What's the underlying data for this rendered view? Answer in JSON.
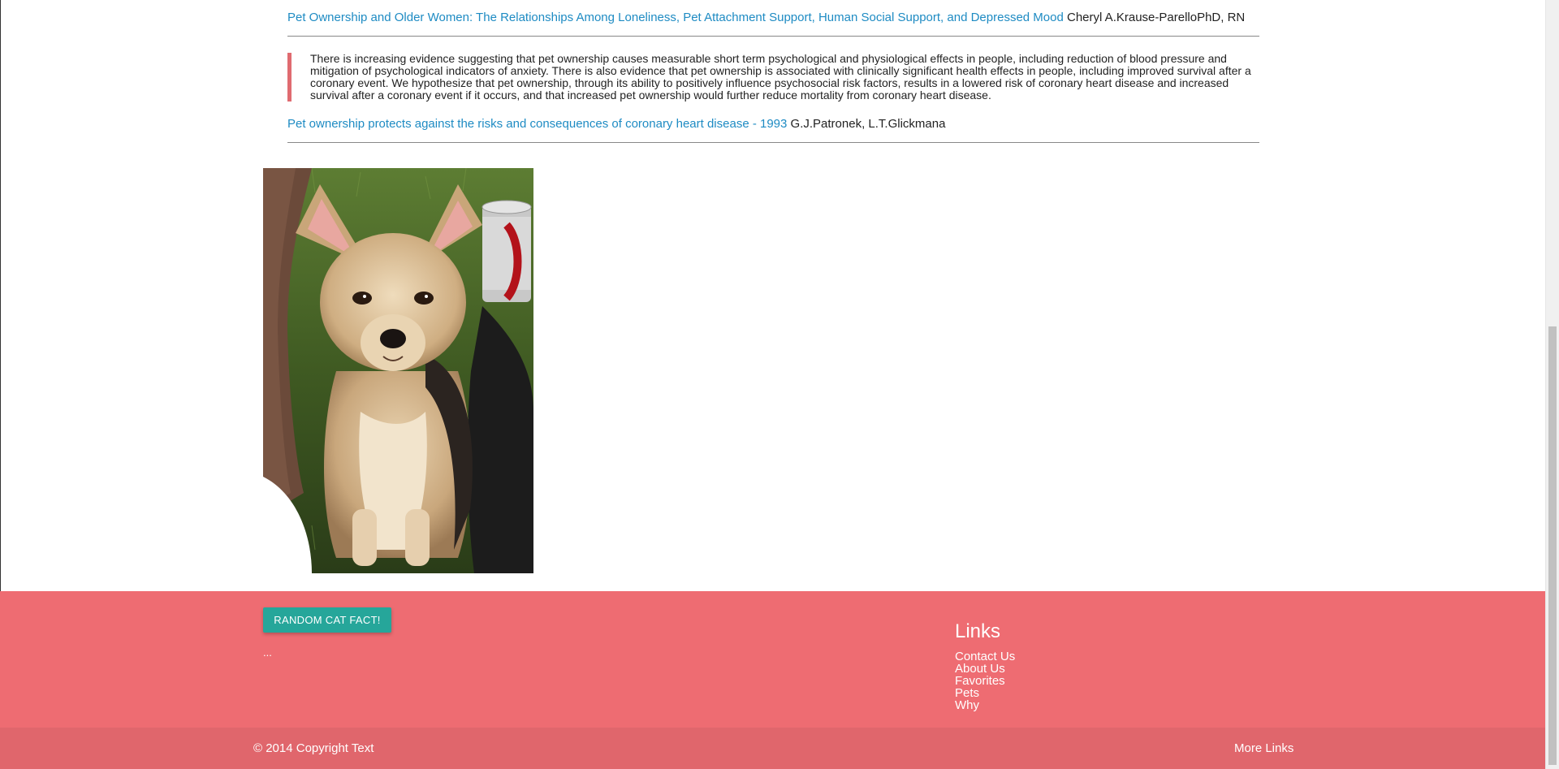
{
  "references": [
    {
      "title": "Pet Ownership and Older Women: The Relationships Among Loneliness, Pet Attachment Support, Human Social Support, and Depressed Mood",
      "authors": "Cheryl A.Krause-ParelloPhD, RN"
    },
    {
      "title": "Pet ownership protects against the risks and consequences of coronary heart disease - 1993",
      "authors": "G.J.Patronek, L.T.Glickmana"
    }
  ],
  "quote": {
    "text": "There is increasing evidence suggesting that pet ownership causes measurable short term psychological and physiological effects in people, including reduction of blood pressure and mitigation of psychological indicators of anxiety. There is also evidence that pet ownership is associated with clinically significant health effects in people, including improved survival after a coronary event. We hypothesize that pet ownership, through its ability to positively influence psychosocial risk factors, results in a lowered risk of coronary heart disease and increased survival after a coronary event if it occurs, and that increased pet ownership would further reduce mortality from coronary heart disease."
  },
  "footer": {
    "cat_button_label": "RANDOM CAT FACT!",
    "cat_fact": "...",
    "links_title": "Links",
    "links": [
      "Contact Us",
      "About Us",
      "Favorites",
      "Pets",
      "Why"
    ],
    "copyright": "© 2014 Copyright Text",
    "more_links": "More Links"
  },
  "colors": {
    "link": "#1e8bc3",
    "footer_bg": "#ee6c72",
    "copyright_bg": "#e0666c",
    "button_bg": "#26a69a",
    "quote_border": "#e06b70"
  },
  "icons": {
    "photo": "chihuahua-dog-photo"
  }
}
